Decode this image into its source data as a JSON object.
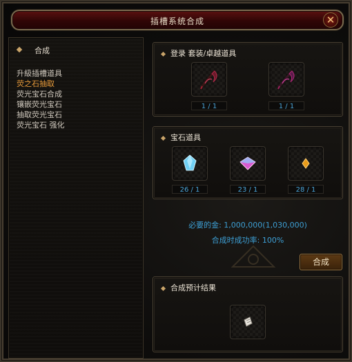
{
  "window": {
    "title": "插槽系统合成",
    "close_symbol": "✕"
  },
  "left_panel": {
    "header": "合成",
    "items": [
      {
        "label": "升級插槽道具",
        "active": false
      },
      {
        "label": "荧之石抽取",
        "active": true
      },
      {
        "label": "荧光宝石合成",
        "active": false
      },
      {
        "label": "镶嵌荧光宝石",
        "active": false
      },
      {
        "label": "抽取荧光宝石",
        "active": false
      },
      {
        "label": "荧光宝石 强化",
        "active": false
      }
    ]
  },
  "equipment_section": {
    "title": "登录 套装/卓越道具",
    "slots": [
      {
        "icon": "scythe-weapon-icon",
        "count": "1 / 1"
      },
      {
        "icon": "scythe-weapon-icon",
        "count": "1 / 1"
      }
    ]
  },
  "gem_section": {
    "title": "宝石道具",
    "slots": [
      {
        "icon": "blue-gem-icon",
        "count": "26 / 1"
      },
      {
        "icon": "pink-gem-icon",
        "count": "23 / 1"
      },
      {
        "icon": "orange-gem-icon",
        "count": "28 / 1"
      }
    ]
  },
  "requirements": {
    "gold": "必要的金: 1,000,000(1,030,000)",
    "success_rate": "合成时成功率: 100%"
  },
  "combine_button": "合成",
  "result_section": {
    "title": "合成预计结果",
    "slot_icon": "scroll-paper-icon"
  },
  "colors": {
    "accent_orange": "#e89b3a",
    "info_blue": "#3d9fd4",
    "title_red": "#4a0c0c"
  }
}
